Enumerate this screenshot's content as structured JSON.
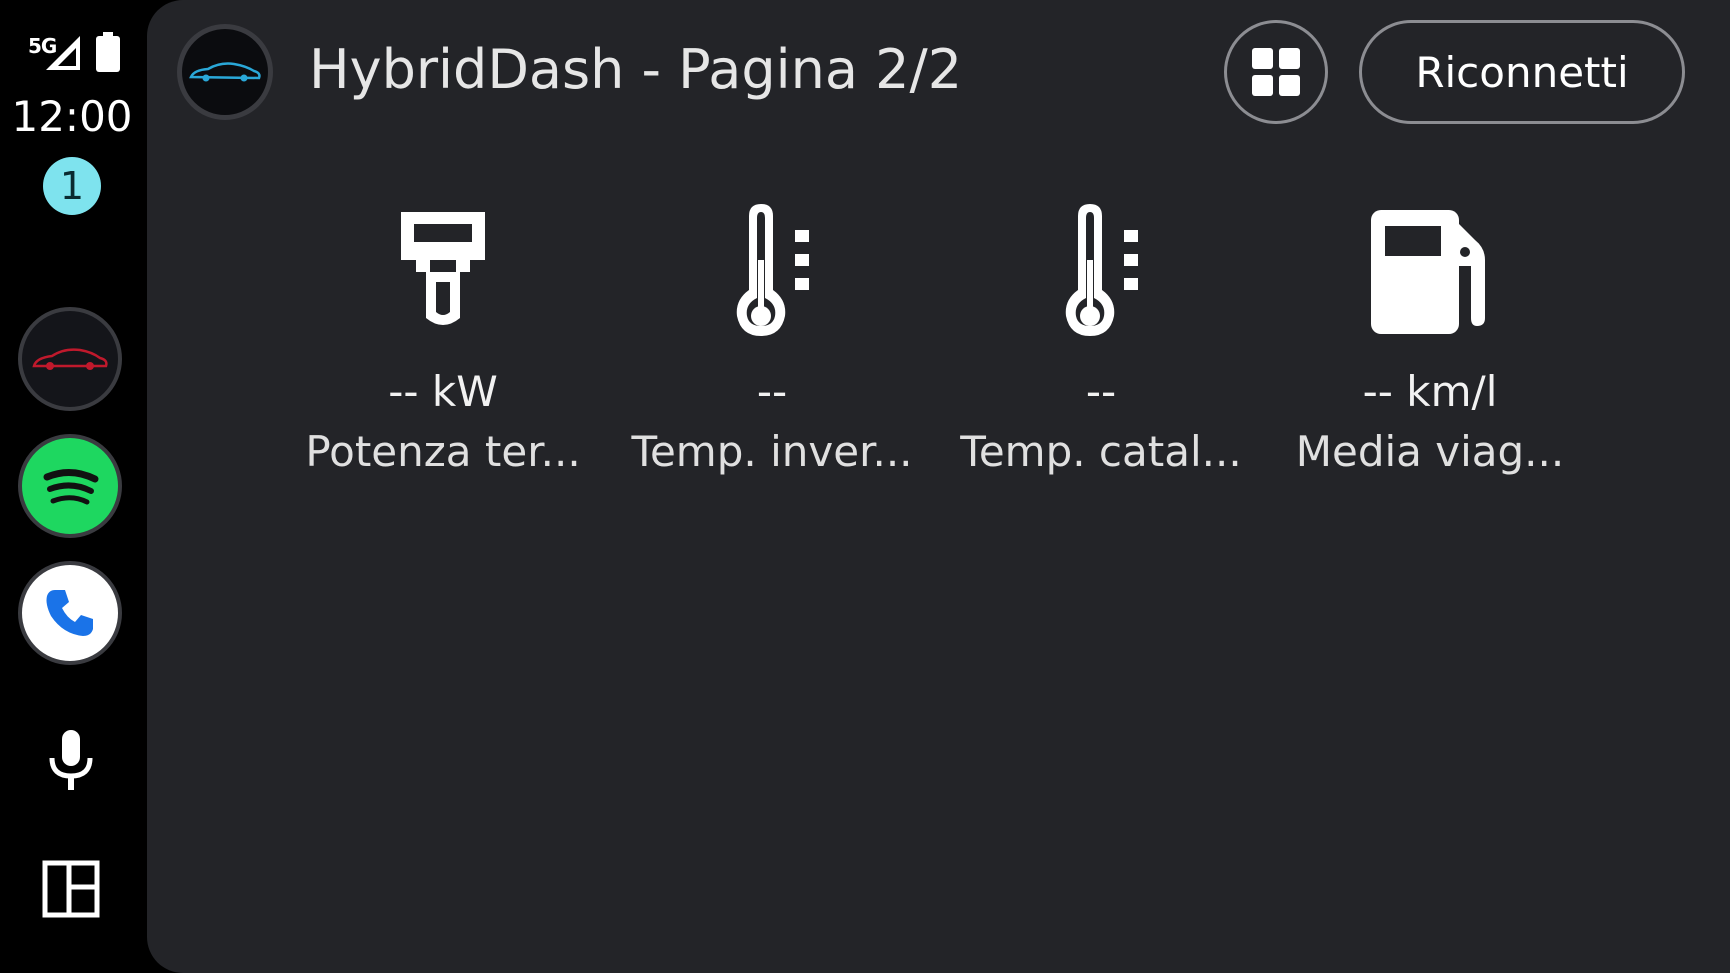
{
  "status_bar": {
    "network": "5G",
    "time": "12:00",
    "notification_count": "1"
  },
  "rail": {
    "apps": [
      {
        "name": "car-app",
        "icon": "car-icon"
      },
      {
        "name": "spotify",
        "icon": "spotify-icon"
      },
      {
        "name": "phone",
        "icon": "phone-icon"
      }
    ],
    "mic_icon": "mic-icon",
    "launcher_icon": "dashboard-icon"
  },
  "header": {
    "title": "HybridDash - Pagina 2/2",
    "grid_icon": "grid-icon",
    "reconnect_label": "Riconnetti"
  },
  "tiles": [
    {
      "icon": "plug-icon",
      "value": "-- kW",
      "label": "Potenza ter..."
    },
    {
      "icon": "thermometer-icon",
      "value": "--",
      "label": "Temp. inver..."
    },
    {
      "icon": "thermometer-icon",
      "value": "--",
      "label": "Temp. catal..."
    },
    {
      "icon": "fuel-icon",
      "value": "-- km/l",
      "label": "Media viag..."
    }
  ],
  "colors": {
    "panel_bg": "#232428",
    "rail_bg": "#000000",
    "badge": "#7ee3ee",
    "spotify": "#1ed760",
    "phone_blue": "#1a73e8",
    "car_blue": "#2aa8d8",
    "car_red": "#c0192c"
  }
}
